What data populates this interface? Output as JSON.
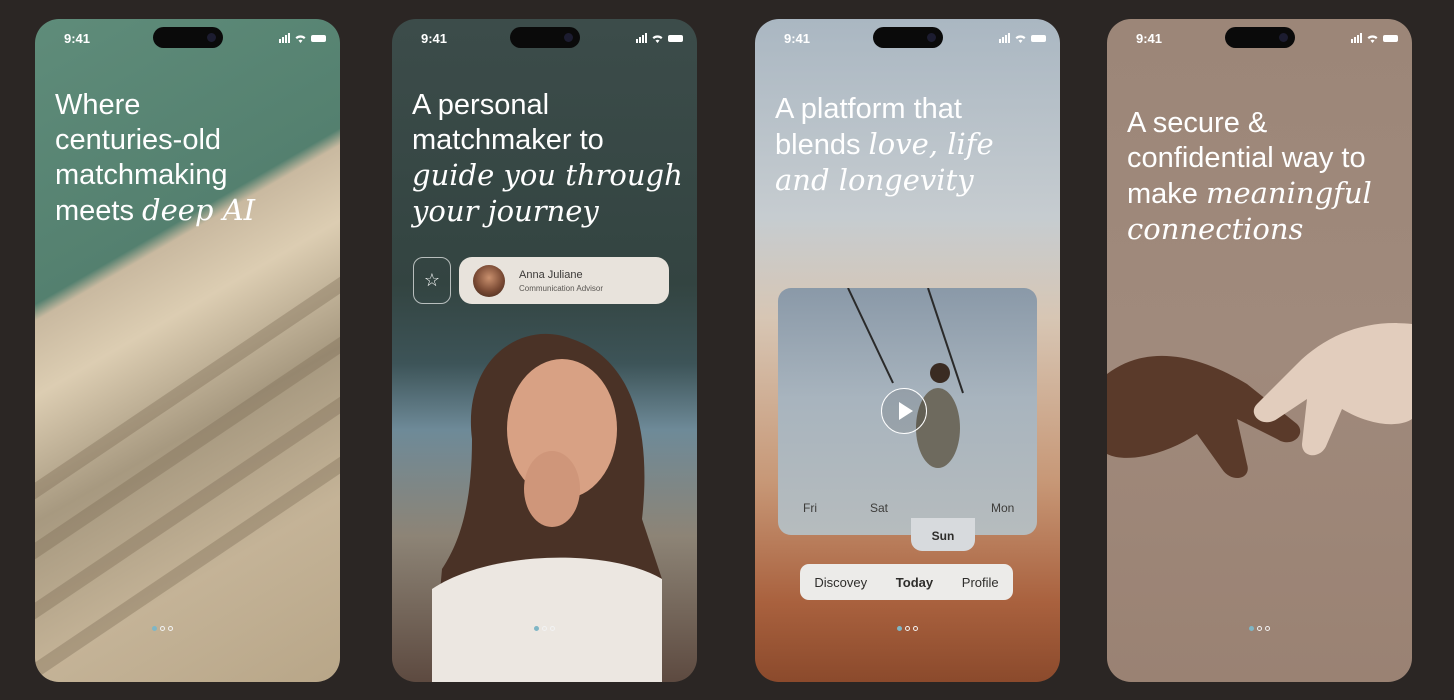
{
  "status_bar": {
    "time": "9:41"
  },
  "screens": [
    {
      "headline_plain": [
        "Where",
        "centuries-old",
        "matchmaking",
        "meets "
      ],
      "headline_italic": "deep AI"
    },
    {
      "headline_plain": [
        "A personal",
        "matchmaker to"
      ],
      "headline_italic": [
        "guide you through",
        "your journey"
      ],
      "advisor": {
        "name": "Anna Juliane",
        "role": "Communication Advisor"
      },
      "icons": {
        "favorite": "star-icon"
      }
    },
    {
      "headline_plain": [
        "A platform that",
        "blends "
      ],
      "headline_italic": [
        "love, life",
        "and longevity"
      ],
      "video": {
        "icon": "play-icon"
      },
      "days": {
        "fri": "Fri",
        "sat": "Sat",
        "mon": "Mon",
        "sun": "Sun"
      },
      "nav": {
        "discover": "Discovey",
        "today": "Today",
        "profile": "Profile"
      }
    },
    {
      "headline_plain": [
        "A secure &",
        "confidential way to",
        "make "
      ],
      "headline_italic": [
        "meaningful",
        "connections"
      ]
    }
  ],
  "pagination": {
    "active_index": 0,
    "total": 3
  },
  "colors": {
    "background": "#2b2624",
    "active_dot": "#7fb6c5"
  }
}
